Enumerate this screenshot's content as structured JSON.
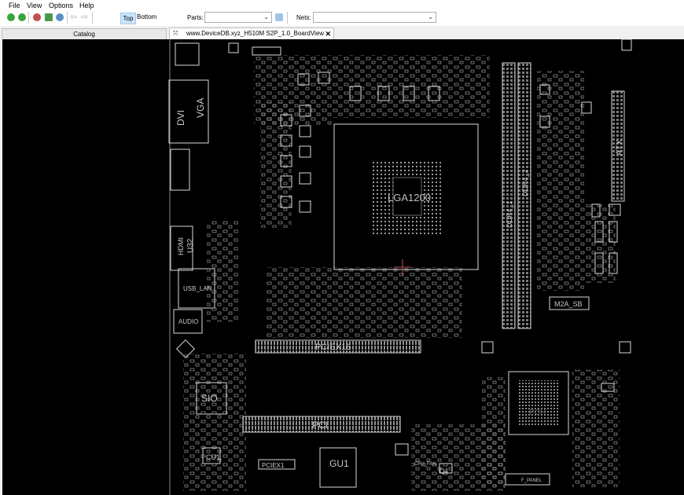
{
  "menu": [
    "File",
    "View",
    "Options",
    "Help"
  ],
  "toolbar": {
    "icons": [
      "open-green-icon",
      "save-green-icon",
      "zoom-in-icon",
      "fit-icon",
      "zoom-out-icon",
      "back-arrow-icon",
      "forward-arrow-icon"
    ],
    "side_top": "Top",
    "side_bottom": "Bottom",
    "parts_label": "Parts:",
    "parts_value": "",
    "nets_label": "Nets:",
    "nets_value": ""
  },
  "tabs": {
    "catalog": "Catalog",
    "board": "www.DeviceDB.xyz_H510M S2P_1.0_BoardView"
  },
  "board_labels": {
    "cpu": "LGA1200",
    "dimm1": "DDR4_1",
    "dimm2": "DDR4_2",
    "atx": "ATX",
    "pciex16": "PCIEX16",
    "pci": "PCI",
    "sio": "SIO",
    "gu1": "GU1",
    "pch": "PCH",
    "m2": "M2A_SB",
    "dvi": "DVI",
    "vga": "VGA",
    "hdmi": "HDMI",
    "u32": "U32",
    "usb_lan": "USB_LAN",
    "audio": "AUDIO",
    "cu1": "CU1",
    "pciex1": "PCIEX1",
    "q4": "Q4",
    "cpu_fan": "CPU_FAN",
    "f_panel": "F_PANEL"
  },
  "colors": {
    "board_bg": "#000000",
    "outline": "#d8d8d8",
    "label": "#c8c8c8",
    "selected_tab": "#cce4f7"
  }
}
